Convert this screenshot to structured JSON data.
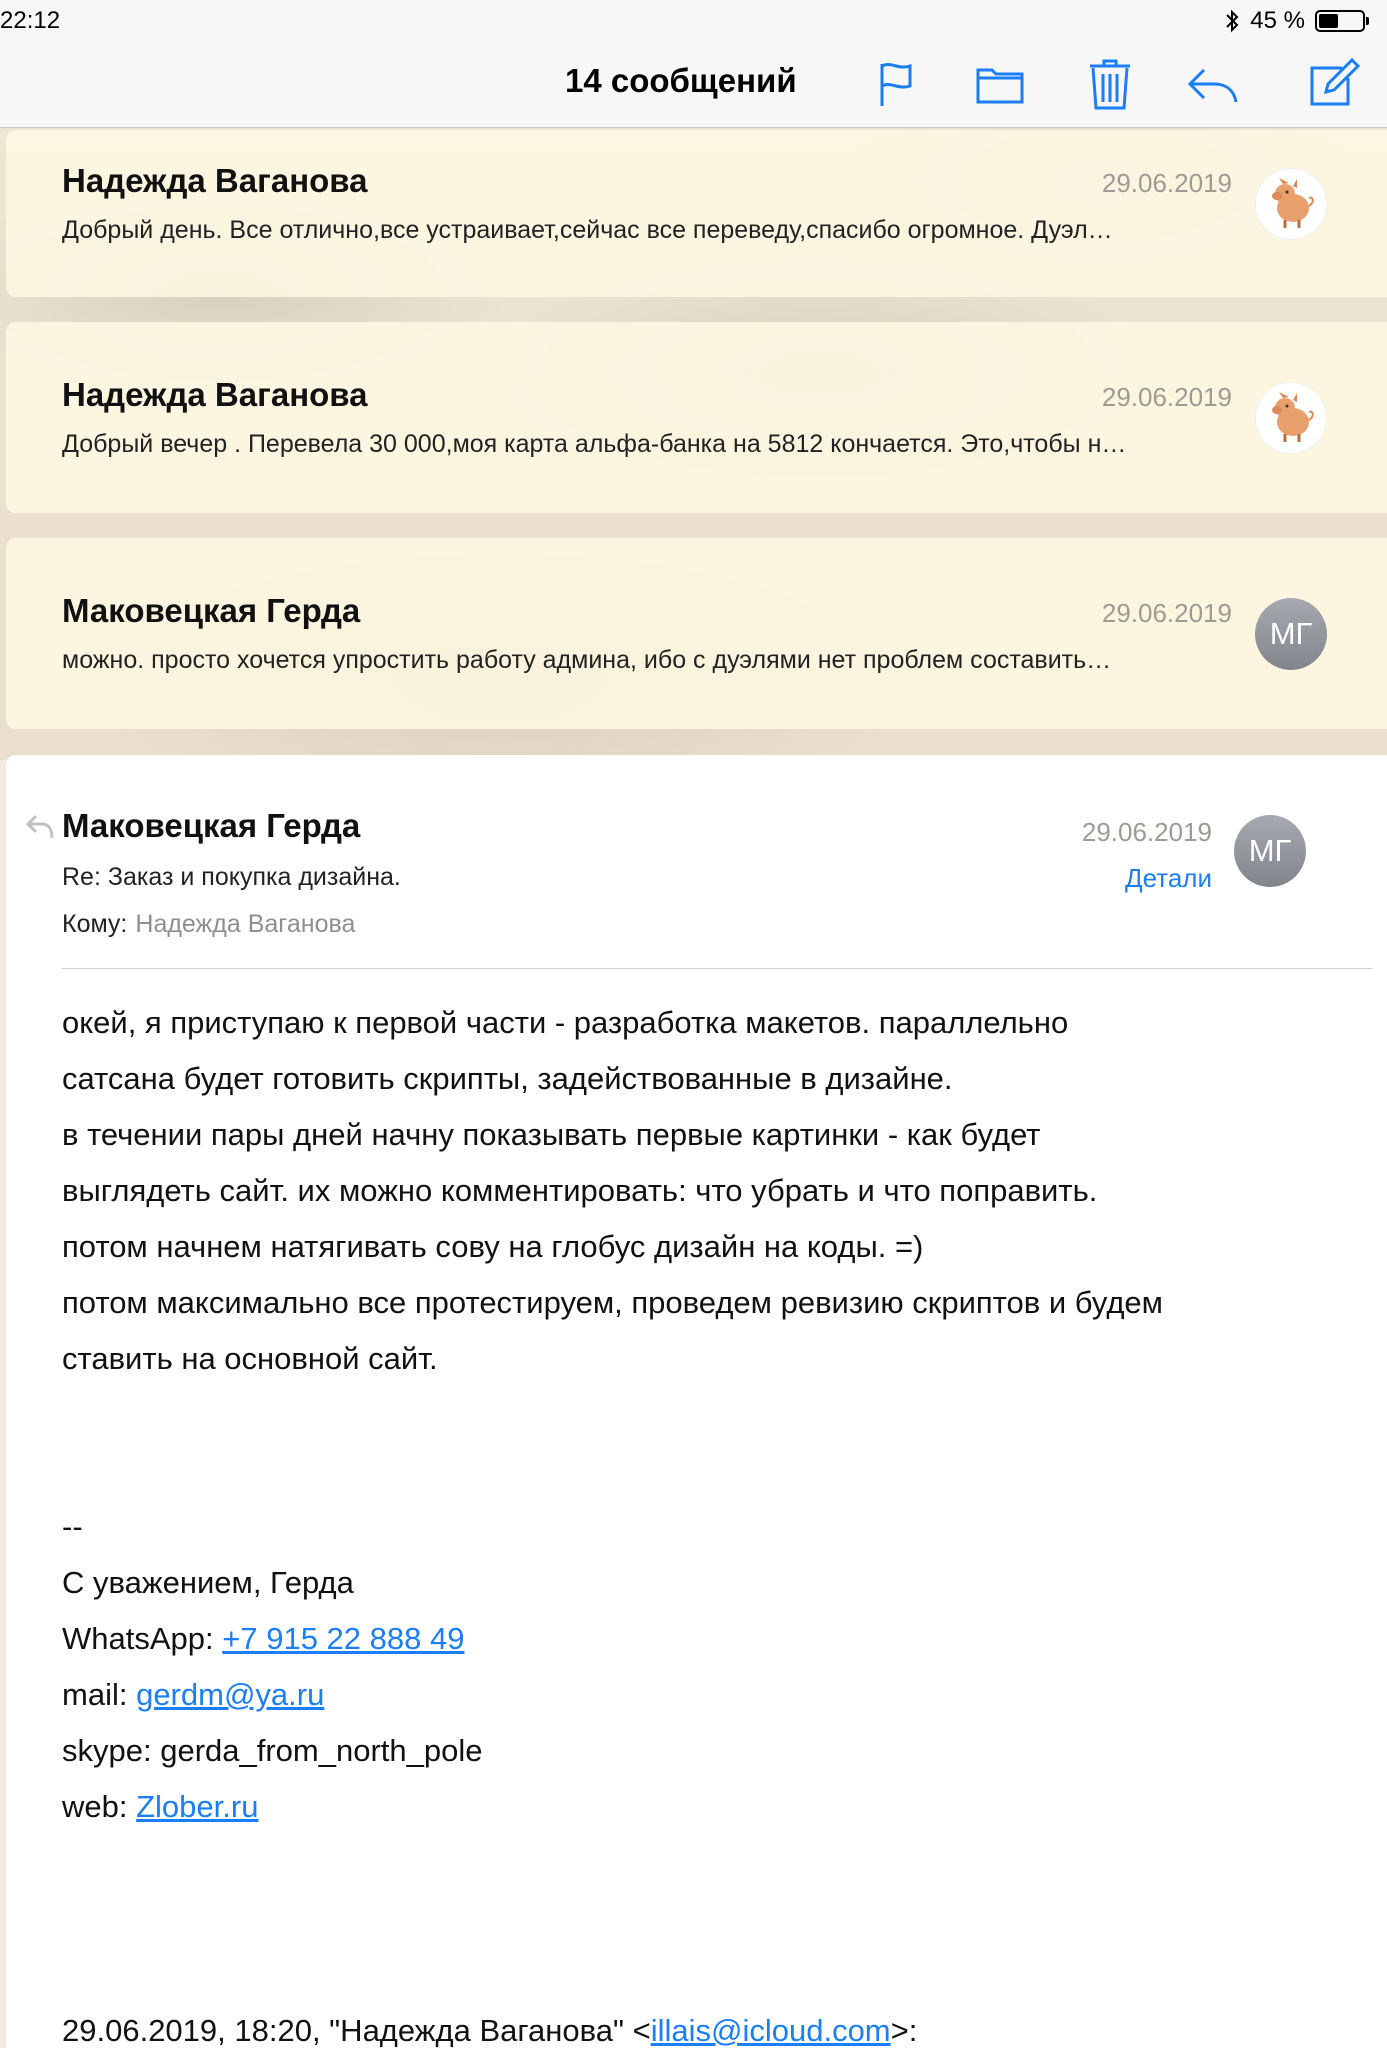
{
  "status_bar": {
    "time": "22:12",
    "battery_text": "45 %",
    "battery_level": 0.45
  },
  "nav": {
    "title": "14 сообщений",
    "icons": [
      "flag-icon",
      "folder-icon",
      "trash-icon",
      "reply-icon",
      "compose-icon"
    ]
  },
  "thread": [
    {
      "sender": "Надежда Ваганова",
      "date": "29.06.2019",
      "preview": "Добрый день. Все отлично,все устраивает,сейчас все переведу,спасибо огромное. Дуэл…",
      "avatar": "pig-avatar"
    },
    {
      "sender": "Надежда Ваганова",
      "date": "29.06.2019",
      "preview": "Добрый вечер . Перевела 30 000,моя карта альфа-банка на 5812 кончается. Это,чтобы н…",
      "avatar": "pig-avatar"
    },
    {
      "sender": "Маковецкая Герда",
      "date": "29.06.2019",
      "preview": "можно. просто хочется упростить работу админа, ибо с дуэлями нет проблем составить…",
      "avatar_initials": "МГ"
    }
  ],
  "message": {
    "sender": "Маковецкая Герда",
    "date": "29.06.2019",
    "subject": "Re: Заказ и покупка дизайна.",
    "details_label": "Детали",
    "to_label": "Кому:",
    "to_value": "Надежда Ваганова",
    "avatar_initials": "МГ",
    "body_lines": [
      "окей, я приступаю к первой части - разработка макетов. параллельно",
      "сатсана будет готовить скрипты, задействованные в дизайне.",
      "в течении пары дней начну показывать первые картинки - как будет",
      "выглядеть сайт. их можно комментировать: что убрать и что поправить.",
      "потом начнем натягивать сову на глобус дизайн на коды. =)",
      "потом максимально все протестируем, проведем ревизию скриптов и будем",
      "ставить на основной сайт."
    ],
    "signature": {
      "dashes": "--",
      "regards": "С уважением, Герда",
      "whatsapp_label": "WhatsApp: ",
      "whatsapp_value": "+7 915 22 888 49",
      "mail_label": "mail: ",
      "mail_value": "gerdm@ya.ru",
      "skype": "skype: gerda_from_north_pole",
      "web_label": "web: ",
      "web_value": "Zlober.ru"
    },
    "quote_header_prefix": "29.06.2019, 18:20, \"Надежда Ваганова\" <",
    "quote_header_email": "illais@icloud.com",
    "quote_header_suffix": ">:"
  },
  "colors": {
    "accent": "#1b7ef5",
    "date_gray": "#9e9a94",
    "card_bg": "#fffae4"
  }
}
